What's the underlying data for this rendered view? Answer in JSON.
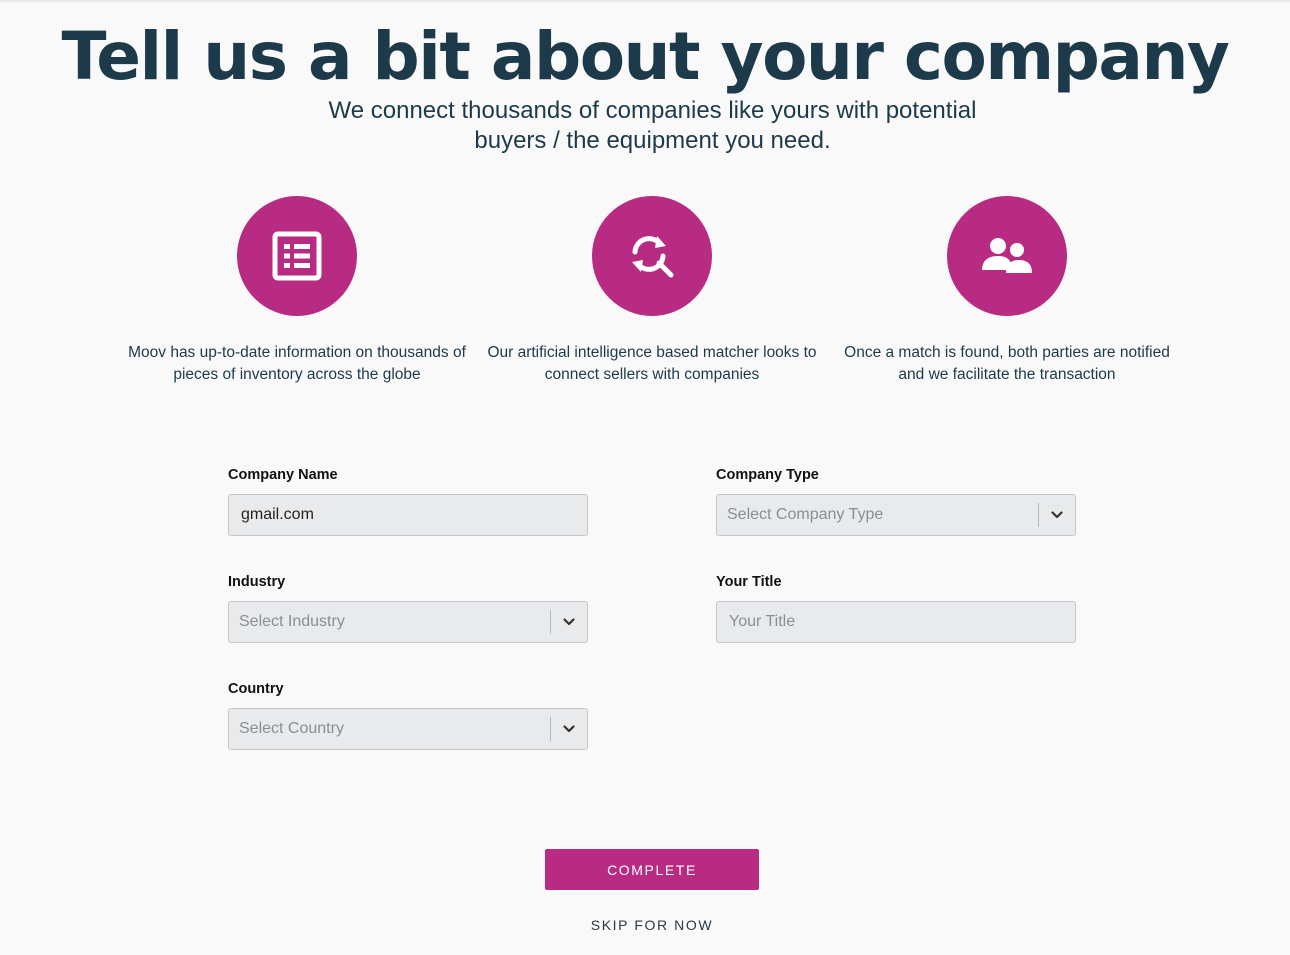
{
  "header": {
    "title": "Tell us a bit about your company",
    "subtitle": "We connect thousands of companies like yours with potential buyers / the equipment you need."
  },
  "features": [
    {
      "icon": "list-document-icon",
      "text": "Moov has up-to-date information on thousands of pieces of inventory across the globe"
    },
    {
      "icon": "search-sync-icon",
      "text": "Our artificial intelligence based matcher looks to connect sellers with companies"
    },
    {
      "icon": "users-icon",
      "text": "Once a match is found, both parties are notified and we facilitate the transaction"
    }
  ],
  "form": {
    "company_name": {
      "label": "Company Name",
      "value": "gmail.com"
    },
    "company_type": {
      "label": "Company Type",
      "placeholder": "Select Company Type"
    },
    "industry": {
      "label": "Industry",
      "placeholder": "Select Industry"
    },
    "your_title": {
      "label": "Your Title",
      "placeholder": "Your Title",
      "value": ""
    },
    "country": {
      "label": "Country",
      "placeholder": "Select Country"
    }
  },
  "actions": {
    "complete_label": "COMPLETE",
    "skip_label": "SKIP FOR NOW"
  },
  "colors": {
    "accent": "#b82b83",
    "heading": "#1d3a4a",
    "background": "#f9f9f9",
    "field_background": "#e9eaec"
  }
}
